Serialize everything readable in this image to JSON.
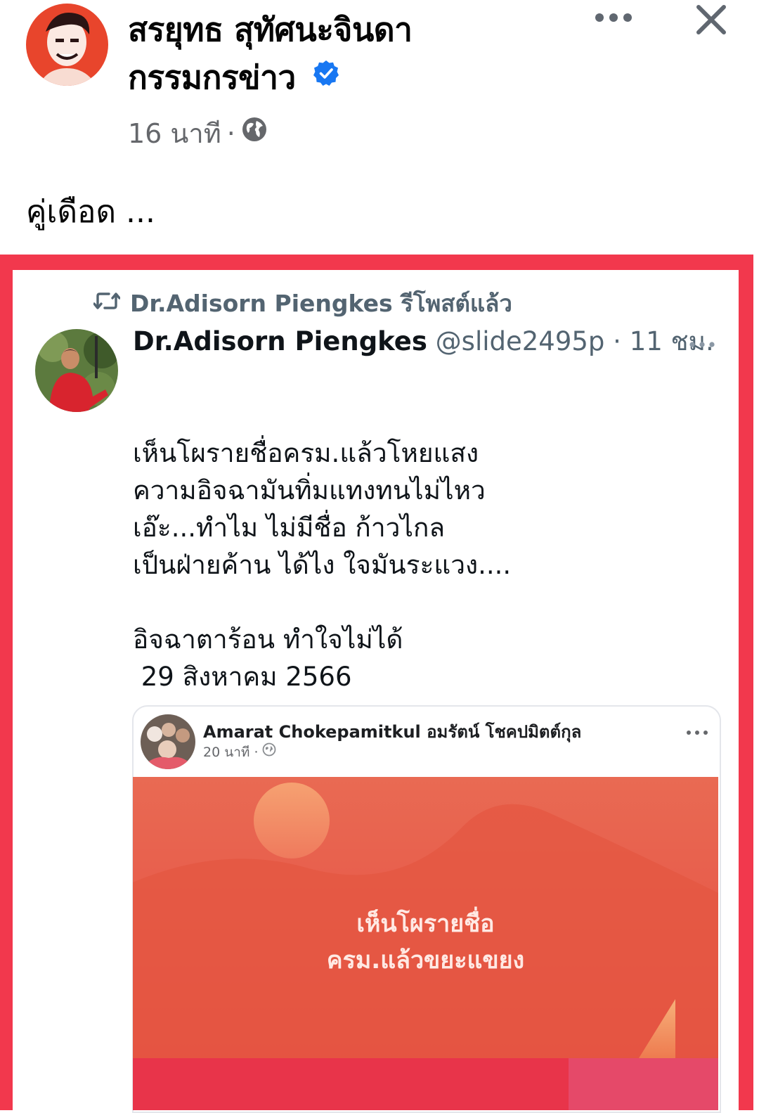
{
  "post": {
    "author_line1": "สรยุทธ สุทัศนะจินดา",
    "author_line2": "กรรมกรข่าว",
    "time": "16 นาที",
    "separator": "·",
    "caption": "คู่เดือด ...",
    "icons": [
      "more-icon",
      "close-icon",
      "globe-icon",
      "verified-badge-icon"
    ]
  },
  "colors": {
    "frame_red": "#f2384d",
    "facebook_blue": "#1877f2",
    "muted_gray": "#65676b",
    "twitter_gray": "#536471"
  },
  "tweet": {
    "retweet_label": "Dr.Adisorn Piengkes รีโพสต์แล้ว",
    "name": "Dr.Adisorn Piengkes",
    "handle_time": "@slide2495p · 11 ชม.",
    "body": "เห็นโผรายชื่อครม.แล้วโหยแสง\nความอิจฉามันทิ่มแทงทนไม่ไหว\nเอ๊ะ...ทำไม ไม่มีชื่อ ก้าวไกล\nเป็นฝ่ายค้าน ได้ไง ใจมันระแวง....\n\nอิจฉาตาร้อน ทำใจไม่ได้\n 29 สิงหาคม 2566"
  },
  "embedded_post": {
    "author": "Amarat Chokepamitkul อมรัตน์ โชคปมิตต์กุล",
    "time": "20 นาที ·",
    "image_text_line1": "เห็นโผรายชื่อ",
    "image_text_line2": "ครม.แล้วขยะแขยง"
  }
}
